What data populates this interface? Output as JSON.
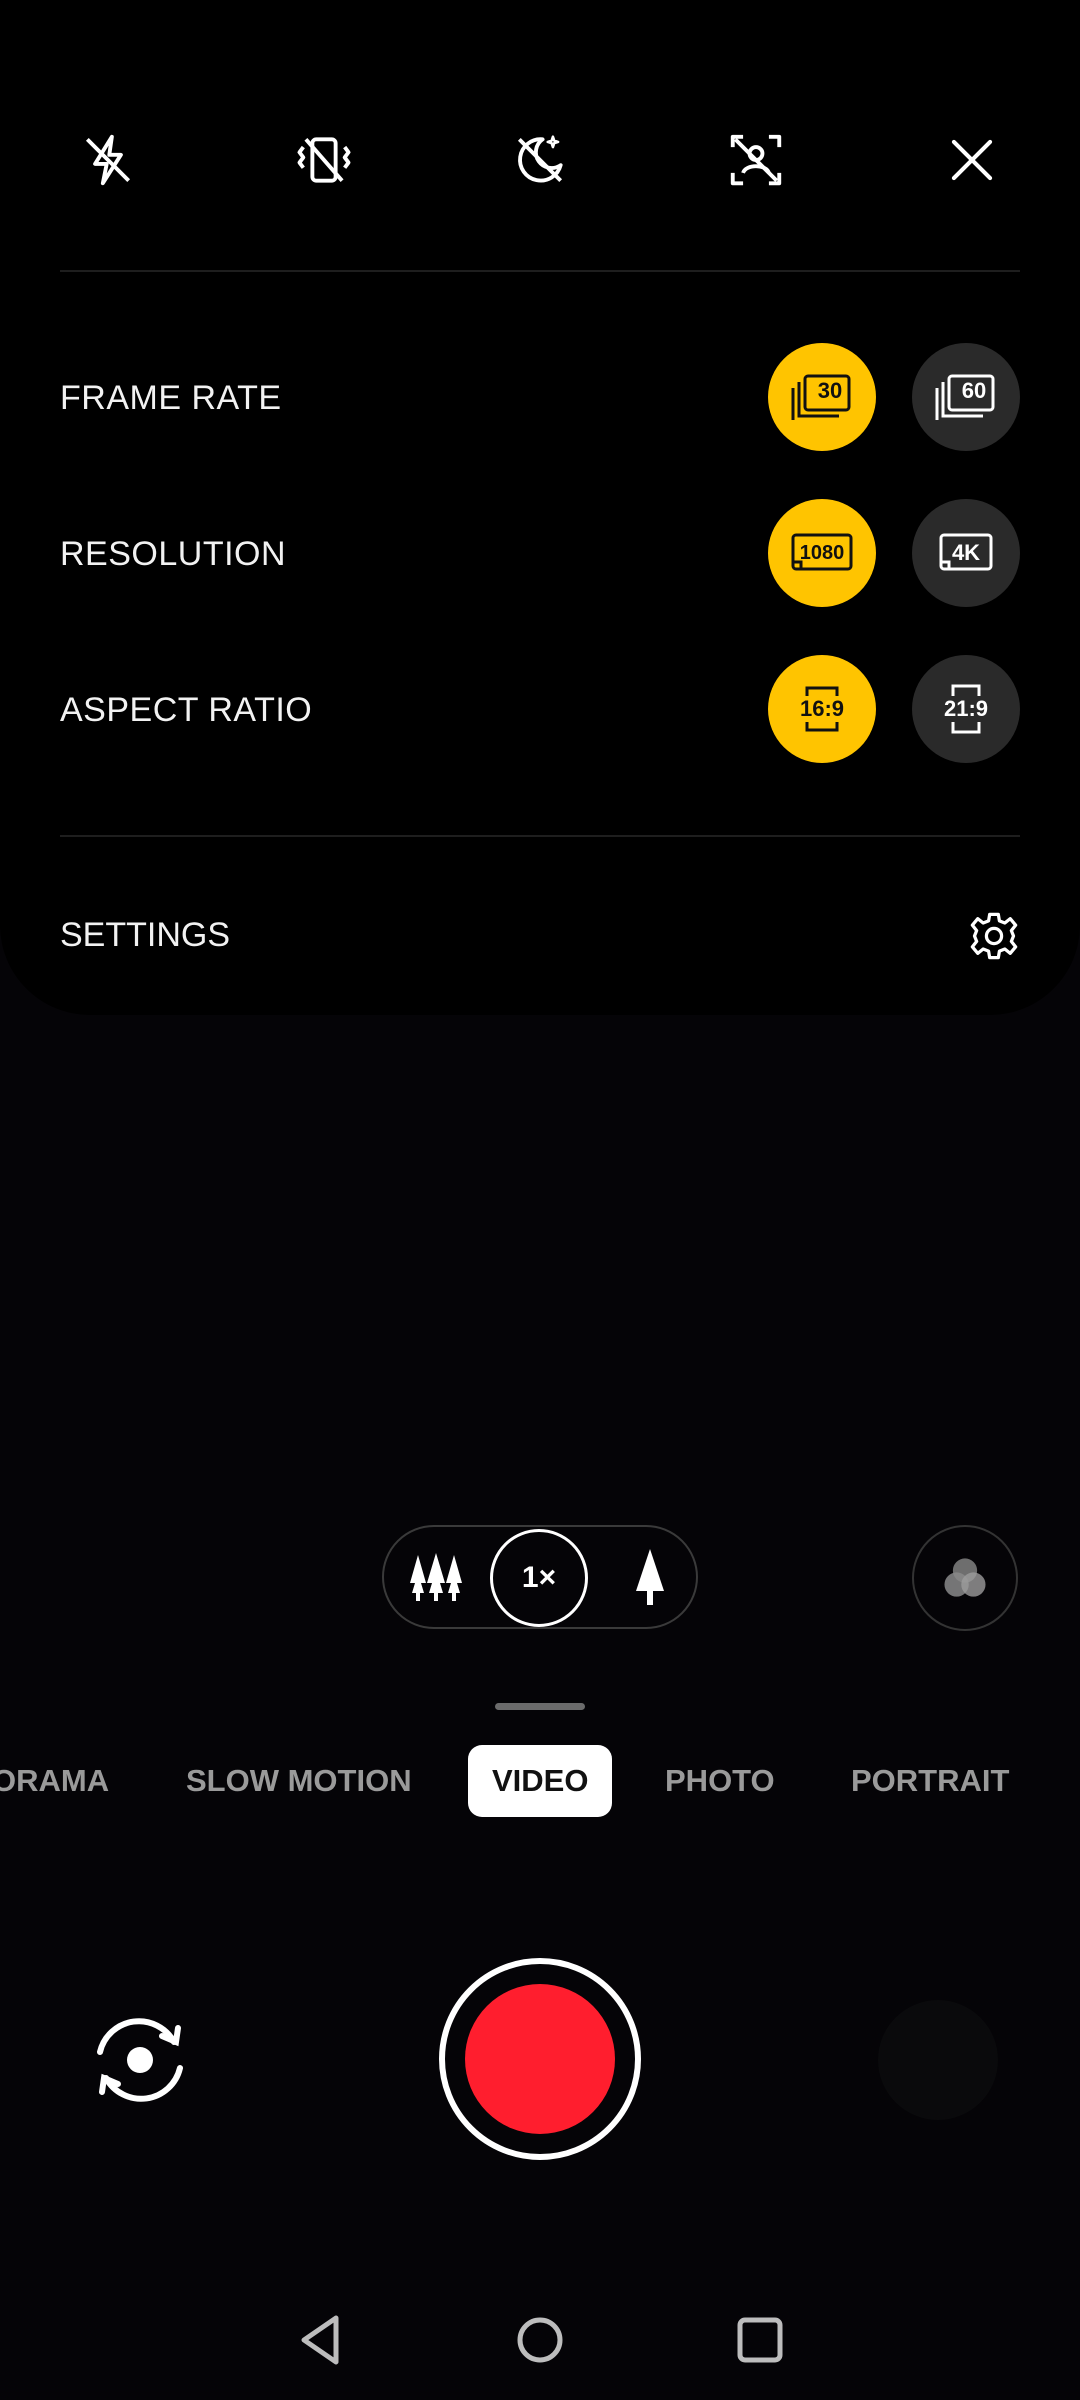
{
  "top_icons": [
    {
      "name": "flash-off-icon"
    },
    {
      "name": "stabilization-off-icon"
    },
    {
      "name": "night-off-icon"
    },
    {
      "name": "focus-tracking-off-icon"
    },
    {
      "name": "close-icon"
    }
  ],
  "options": [
    {
      "label": "FRAME RATE",
      "choices": [
        {
          "text": "30",
          "active": true,
          "icon": "frame-rate-30-icon"
        },
        {
          "text": "60",
          "active": false,
          "icon": "frame-rate-60-icon"
        }
      ]
    },
    {
      "label": "RESOLUTION",
      "choices": [
        {
          "text": "1080",
          "active": true,
          "icon": "resolution-1080-icon"
        },
        {
          "text": "4K",
          "active": false,
          "icon": "resolution-4k-icon"
        }
      ]
    },
    {
      "label": "ASPECT RATIO",
      "choices": [
        {
          "text": "16:9",
          "active": true,
          "icon": "aspect-16-9-icon"
        },
        {
          "text": "21:9",
          "active": false,
          "icon": "aspect-21-9-icon"
        }
      ]
    }
  ],
  "settings": {
    "label": "SETTINGS",
    "icon": "gear-icon"
  },
  "zoom": {
    "level": "1×"
  },
  "modes": [
    "ORAMA",
    "SLOW MOTION",
    "VIDEO",
    "PHOTO",
    "PORTRAIT"
  ],
  "active_mode": "VIDEO",
  "colors": {
    "accent": "#ffc400",
    "record": "#ff1e2e",
    "inactive_button": "#2a2a2a"
  }
}
